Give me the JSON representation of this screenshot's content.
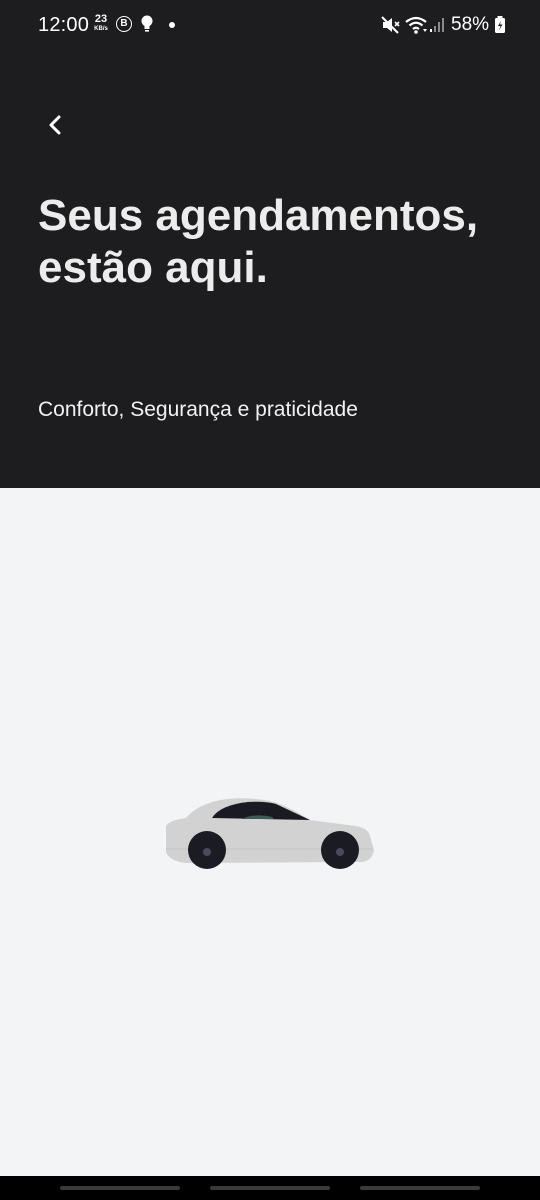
{
  "status_bar": {
    "time": "12:00",
    "net_speed_value": "23",
    "net_speed_unit": "KB/s",
    "b_badge": "B",
    "battery": "58%",
    "icons": [
      "bulb-icon",
      "dot-icon",
      "mute-icon",
      "wifi-icon",
      "signal-icon",
      "battery-icon"
    ]
  },
  "header": {
    "title": "Seus agendamentos, estão aqui.",
    "subtitle": "Conforto, Segurança e praticidade",
    "background_color": "#1d1d20"
  },
  "content": {
    "background_color": "#f3f4f6",
    "illustration": "car-illustration"
  }
}
